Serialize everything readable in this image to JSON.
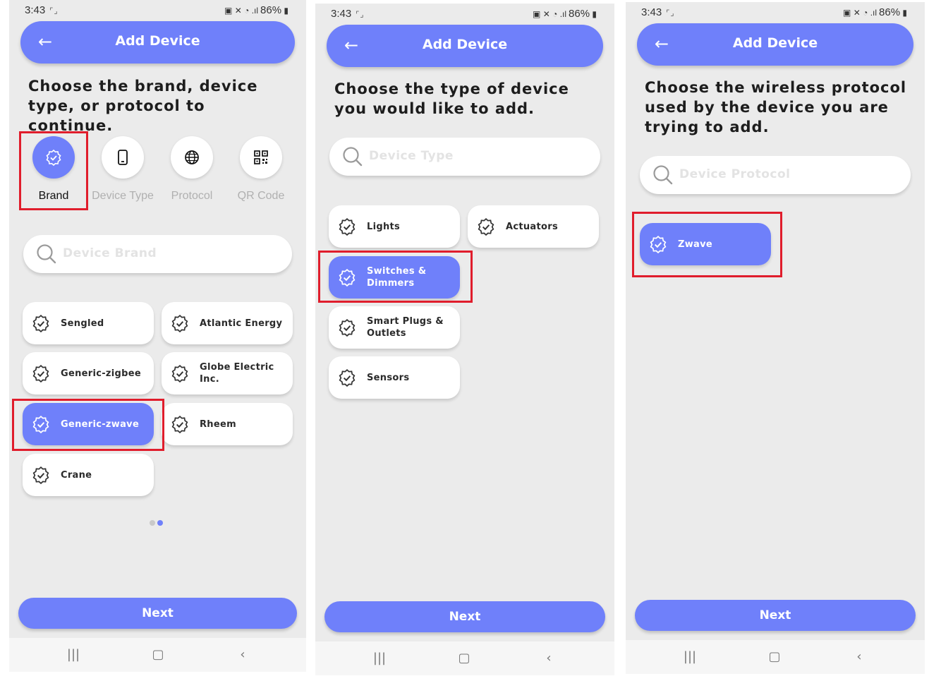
{
  "status": {
    "time": "3:43",
    "battery": "86%"
  },
  "screen1": {
    "title": "Add Device",
    "heading": "Choose the brand, device type, or protocol to continue.",
    "methods": [
      {
        "label": "Brand"
      },
      {
        "label": "Device Type"
      },
      {
        "label": "Protocol"
      },
      {
        "label": "QR Code"
      }
    ],
    "search_placeholder": "Device Brand",
    "brands": [
      "Sengled",
      "Atlantic Energy",
      "Generic-zigbee",
      "Globe Electric Inc.",
      "Generic-zwave",
      "Rheem",
      "Crane"
    ],
    "selected_brand": "Generic-zwave",
    "next_label": "Next"
  },
  "screen2": {
    "title": "Add Device",
    "heading": "Choose the type of device you would like to add.",
    "search_placeholder": "Device Type",
    "types": [
      "Lights",
      "Actuators",
      "Switches & Dimmers",
      "Smart Plugs & Outlets",
      "Sensors"
    ],
    "selected_type": "Switches & Dimmers",
    "next_label": "Next"
  },
  "screen3": {
    "title": "Add Device",
    "heading": "Choose the wireless protocol used by the device you are trying to add.",
    "search_placeholder": "Device Protocol",
    "protocols": [
      "Zwave"
    ],
    "selected_protocol": "Zwave",
    "next_label": "Next"
  },
  "colors": {
    "accent": "#6f80fa",
    "highlight": "#e01d2c",
    "background": "#ebebeb"
  }
}
